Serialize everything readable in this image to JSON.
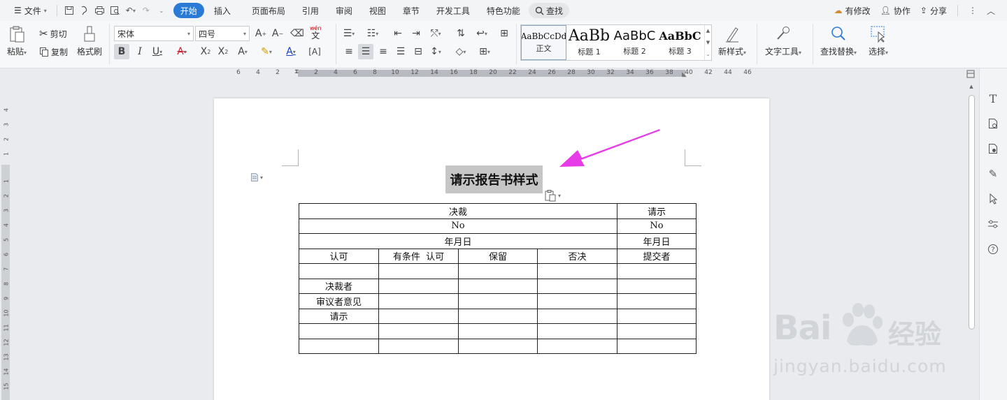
{
  "menubar": {
    "file": "文件",
    "tabs": [
      "开始",
      "插入",
      "页面布局",
      "引用",
      "审阅",
      "视图",
      "章节",
      "开发工具",
      "特色功能"
    ],
    "search": "查找",
    "right": {
      "changes": "有修改",
      "collab": "协作",
      "share": "分享"
    }
  },
  "ribbon": {
    "paste": "粘贴",
    "cut": "剪切",
    "copy": "复制",
    "format_painter": "格式刷",
    "font_name": "宋体",
    "font_size": "四号",
    "phonetic": "wén",
    "phonetic_char": "文",
    "styles": [
      {
        "sample": "AaBbCcDd",
        "label": "正文"
      },
      {
        "sample": "AaBb",
        "label": "标题 1"
      },
      {
        "sample": "AaBbC",
        "label": "标题 2"
      },
      {
        "sample": "AaBbC",
        "label": "标题 3"
      }
    ],
    "new_style": "新样式",
    "text_tools": "文字工具",
    "find_replace": "查找替换",
    "select": "选择"
  },
  "ruler": {
    "h_numbers": [
      "6",
      "4",
      "2",
      "2",
      "4",
      "6",
      "8",
      "10",
      "12",
      "14",
      "16",
      "18",
      "20",
      "22",
      "24",
      "26",
      "28",
      "30",
      "32",
      "34",
      "36",
      "38",
      "40",
      "42",
      "44",
      "46"
    ],
    "v_numbers": [
      "4",
      "3",
      "2",
      "1",
      "1",
      "2",
      "3",
      "4",
      "5",
      "6",
      "7",
      "8",
      "9",
      "10",
      "11",
      "12",
      "13",
      "14",
      "15"
    ]
  },
  "document": {
    "title": "请示报告书样式",
    "table": {
      "r1": {
        "left": "决裁",
        "right": "请示"
      },
      "r2": {
        "left": "No",
        "right": "No"
      },
      "r3": {
        "left": "年月日",
        "right": "年月日"
      },
      "r4": [
        "认可",
        "有条件  认可",
        "保留",
        "否决",
        "提交者"
      ],
      "row_labels": [
        "",
        "决裁者",
        "审议者意见",
        "请示",
        "",
        ""
      ]
    }
  },
  "watermark": {
    "brand": "Bai",
    "brand_cn": "经验",
    "url": "jingyan.baidu.com"
  },
  "colors": {
    "accent": "#2b7bd6",
    "arrow": "#e63be6",
    "selection": "#c6c6c6"
  }
}
